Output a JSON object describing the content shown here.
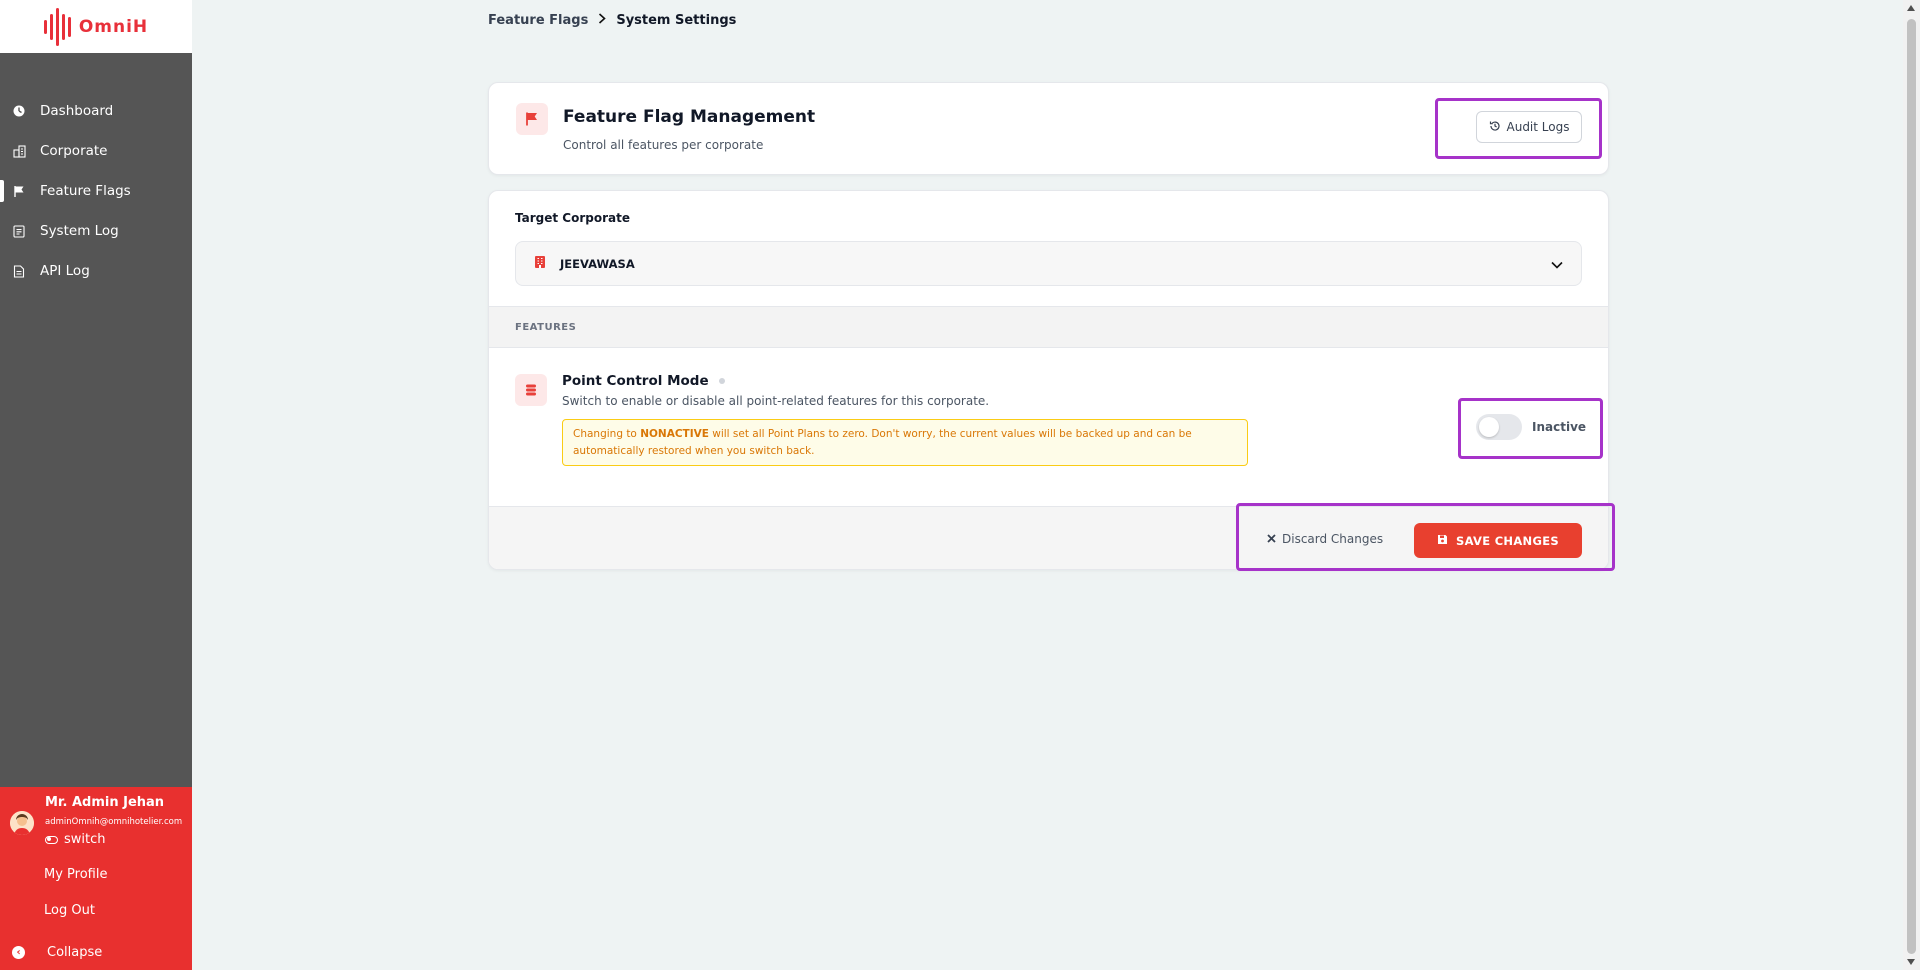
{
  "app": {
    "logo_text": "OmniH"
  },
  "sidebar": {
    "items": [
      {
        "label": "Dashboard",
        "icon": "dashboard-icon"
      },
      {
        "label": "Corporate",
        "icon": "building-icon"
      },
      {
        "label": "Feature Flags",
        "icon": "flag-icon",
        "active": true
      },
      {
        "label": "System Log",
        "icon": "document-icon"
      },
      {
        "label": "API Log",
        "icon": "document-icon"
      }
    ]
  },
  "user": {
    "name": "Mr. Admin Jehan",
    "email": "adminOmnih@omnihotelier.com",
    "switch_label": "switch",
    "my_profile": "My Profile",
    "logout": "Log Out",
    "collapse": "Collapse"
  },
  "breadcrumb": {
    "parent": "Feature Flags",
    "current": "System Settings"
  },
  "header": {
    "title": "Feature Flag Management",
    "subtitle": "Control all features per corporate",
    "audit_button": "Audit Logs"
  },
  "target": {
    "label": "Target Corporate",
    "selected": "JEEVAWASA"
  },
  "features": {
    "section_label": "FEATURES",
    "items": [
      {
        "title": "Point Control Mode",
        "description": "Switch to enable or disable all point-related features for this corporate.",
        "warning_prefix": "Changing to ",
        "warning_keyword": "NONACTIVE",
        "warning_suffix": " will set all Point Plans to zero. Don't worry, the current values will be backed up and can be automatically restored when you switch back.",
        "status": "Inactive",
        "enabled": false
      }
    ]
  },
  "actions": {
    "discard": "Discard Changes",
    "save": "SAVE CHANGES"
  },
  "colors": {
    "brand_red": "#e8302f",
    "sidebar": "#555555",
    "highlight": "#a633c9",
    "warning": "#d97706"
  }
}
